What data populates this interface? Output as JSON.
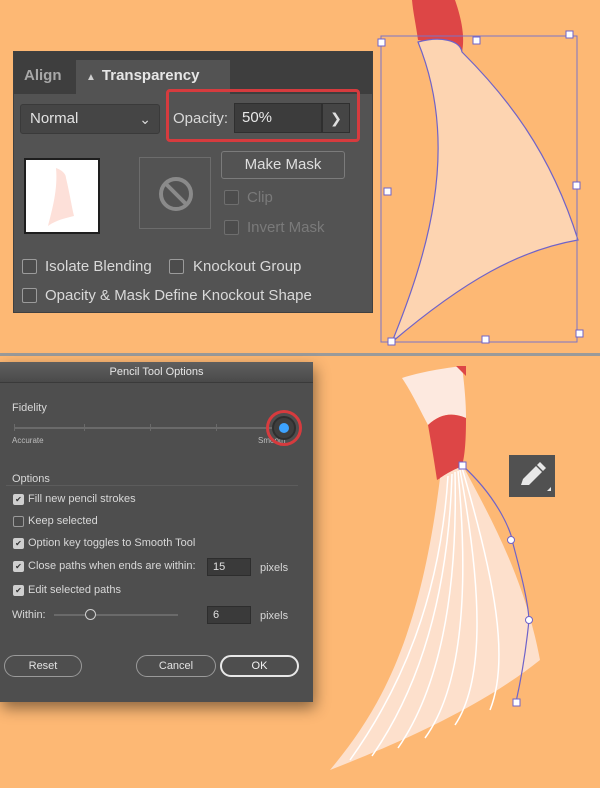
{
  "transparency_panel": {
    "tabs": [
      {
        "label": "Align"
      },
      {
        "label": "Transparency"
      }
    ],
    "blend_mode": "Normal",
    "opacity_label": "Opacity:",
    "opacity_value": "50%",
    "make_mask_label": "Make Mask",
    "clip_label": "Clip",
    "invert_mask_label": "Invert Mask",
    "isolate_blending_label": "Isolate Blending",
    "knockout_group_label": "Knockout Group",
    "opacity_mask_label": "Opacity & Mask Define Knockout Shape"
  },
  "pencil_dialog": {
    "title": "Pencil Tool Options",
    "fidelity_label": "Fidelity",
    "fidelity_min_label": "Accurate",
    "fidelity_max_label": "Smooth",
    "fidelity_value": 1.0,
    "options_label": "Options",
    "options": [
      {
        "label": "Fill new pencil strokes",
        "checked": true
      },
      {
        "label": "Keep selected",
        "checked": false
      },
      {
        "label": "Option key toggles to Smooth Tool",
        "checked": true
      },
      {
        "label": "Close paths when ends are within:",
        "checked": true
      },
      {
        "label": "Edit selected paths",
        "checked": true
      }
    ],
    "close_paths_value": "15",
    "close_paths_unit": "pixels",
    "within_label": "Within:",
    "within_value": "6",
    "within_unit": "pixels",
    "within_slider_value": 0.3,
    "reset_label": "Reset",
    "cancel_label": "Cancel",
    "ok_label": "OK"
  },
  "colors": {
    "background": "#fdb874",
    "panel": "#535353",
    "highlight": "#d63b3e",
    "shape_fill": "#fdd4b1",
    "selection": "#6f63c9",
    "red_accent": "#dd4646"
  },
  "icons": {
    "no_mask": "no-symbol-icon",
    "pencil": "pencil-icon"
  }
}
